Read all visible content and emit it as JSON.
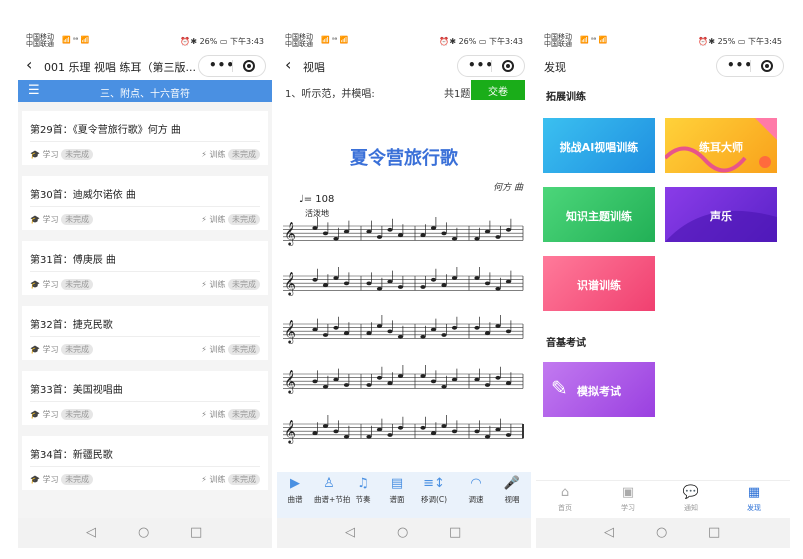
{
  "status": {
    "carrier_1": "中国移动",
    "carrier_2": "中国联通",
    "signals": "📶 ᵃᵃ 📶",
    "screen1_battery": "26%",
    "screen1_time": "下午3:43",
    "screen2_battery": "26%",
    "screen2_time": "下午3:43",
    "screen3_battery": "25%",
    "screen3_time": "下午3:45"
  },
  "screen1": {
    "title": "001 乐理 视唱 练耳（第三版...",
    "section": "三、附点、十六音符",
    "study_label": "学习",
    "train_label": "训练",
    "status_label": "未完成",
    "songs": [
      "第29首：《夏令营旅行歌》何方 曲",
      "第30首：迪威尔诺依 曲",
      "第31首：傅庚辰 曲",
      "第32首：捷克民歌",
      "第33首：美国视唱曲",
      "第34首：新疆民歌"
    ]
  },
  "screen2": {
    "title": "视唱",
    "question": "1、听示范，并模唱:",
    "count": "共1题",
    "submit": "交卷",
    "song_title": "夏令营旅行歌",
    "composer": "何方 曲",
    "tempo": "♩= 108",
    "expression": "活泼地",
    "tools": [
      "曲谱",
      "曲谱+节拍",
      "节奏",
      "谱面",
      "移调(C)",
      "调速",
      "视唱"
    ]
  },
  "screen3": {
    "title": "发现",
    "section1": "拓展训练",
    "tiles": [
      "挑战AI视唱训练",
      "练耳大师",
      "知识主题训练",
      "声乐",
      "识谱训练"
    ],
    "section2": "音基考试",
    "exam_tile": "模拟考试",
    "tabs": [
      "首页",
      "学习",
      "通知",
      "发现"
    ]
  },
  "colors": {
    "primary_blue": "#4a90e2",
    "submit_green": "#1aad19",
    "title_blue": "#3a70d8",
    "active_tab": "#2a6fd6"
  }
}
